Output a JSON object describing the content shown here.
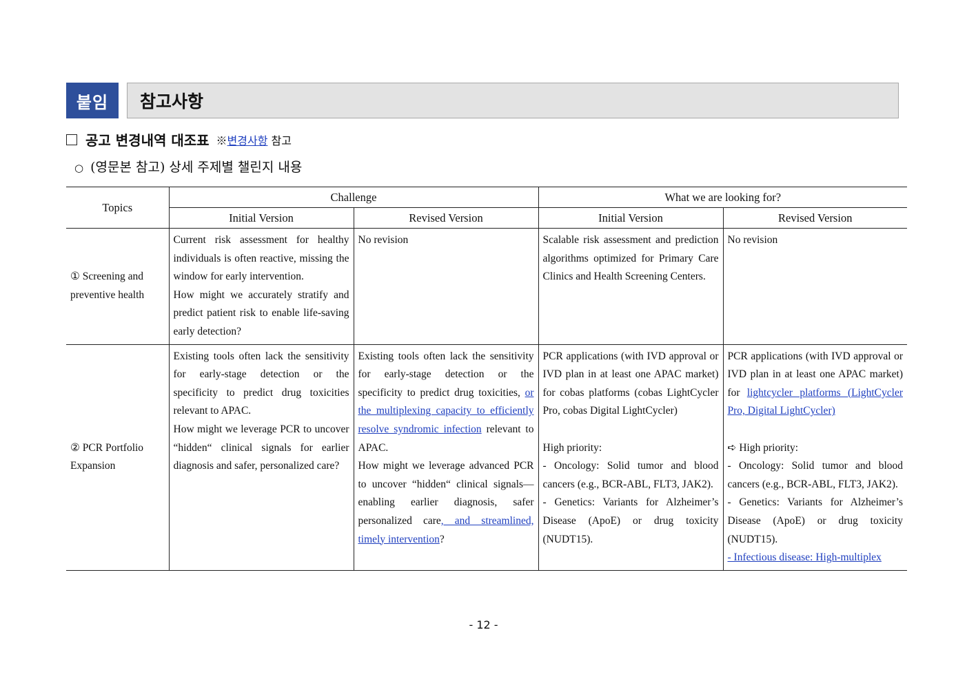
{
  "header": {
    "tag": "붙임",
    "title": "참고사항"
  },
  "section": {
    "checkbox": "",
    "title": "공고 변경내역 대조표",
    "note_prefix": "※",
    "note_link": "변경사항",
    "note_suffix": "참고"
  },
  "subheading": {
    "bullet": "○",
    "text": "(영문본 참고) 상세 주제별 챌린지 내용"
  },
  "table": {
    "col_topics": "Topics",
    "col_challenge": "Challenge",
    "col_looking": "What we are looking for?",
    "sub_initial": "Initial Version",
    "sub_revised": "Revised Version",
    "rows": [
      {
        "topic": "① Screening and preventive health",
        "challenge_initial": [
          "Current risk assessment for healthy individuals is often reactive, missing the window for early intervention.",
          "How might we accurately stratify and predict patient risk to enable life-saving early detection?"
        ],
        "challenge_revised": "No revision",
        "looking_initial": "Scalable risk assessment and prediction algorithms optimized for Primary Care Clinics and Health Screening Centers.",
        "looking_revised": "No revision"
      },
      {
        "topic": "② PCR Portfolio Expansion",
        "challenge_initial": [
          "Existing tools often lack the sensitivity for early-stage detection or the specificity to predict drug toxicities relevant to APAC.",
          "How might we leverage PCR to uncover “hidden“ clinical signals for earlier diagnosis and safer, personalized care?"
        ],
        "challenge_revised": {
          "p1_a": "Existing tools often lack the sensitivity for early-stage detection or the specificity to predict drug toxicities, ",
          "p1_link": "or the multiplexing capacity to efficiently resolve syndromic infection",
          "p1_b": " relevant to APAC.",
          "p2_a": "How might we leverage advanced PCR to uncover “hidden“ clinical signals—enabling earlier diagnosis, safer personalized care",
          "p2_link": ", and streamlined, timely intervention",
          "p2_b": "?"
        },
        "looking_initial": {
          "intro": "PCR applications (with IVD approval or IVD plan  in at least one APAC market) for cobas platforms (cobas LightCycler Pro, cobas Digital LightCycler)",
          "priority": "High priority:",
          "item1": "- Oncology: Solid tumor and blood cancers (e.g., BCR-ABL, FLT3, JAK2).",
          "item2": "- Genetics: Variants for Alzheimer’s Disease (ApoE) or drug toxicity (NUDT15)."
        },
        "looking_revised": {
          "intro_a": "PCR applications (with IVD approval or IVD plan  in at least one APAC market) for ",
          "intro_link": "lightcycler platforms (LightCycler Pro, Digital LightCycler)",
          "priority": "➪ High priority:",
          "item1": "- Oncology: Solid tumor and blood cancers (e.g., BCR-ABL, FLT3, JAK2).",
          "item2": "- Genetics: Variants for Alzheimer’s Disease (ApoE) or drug toxicity (NUDT15).",
          "item3": "- Infectious disease: High-multiplex"
        }
      }
    ]
  },
  "page_number": "- 12 -",
  "colors": {
    "tag_bg": "#2e4f9b",
    "title_bg": "#e3e3e3",
    "link": "#1f3fbf"
  }
}
